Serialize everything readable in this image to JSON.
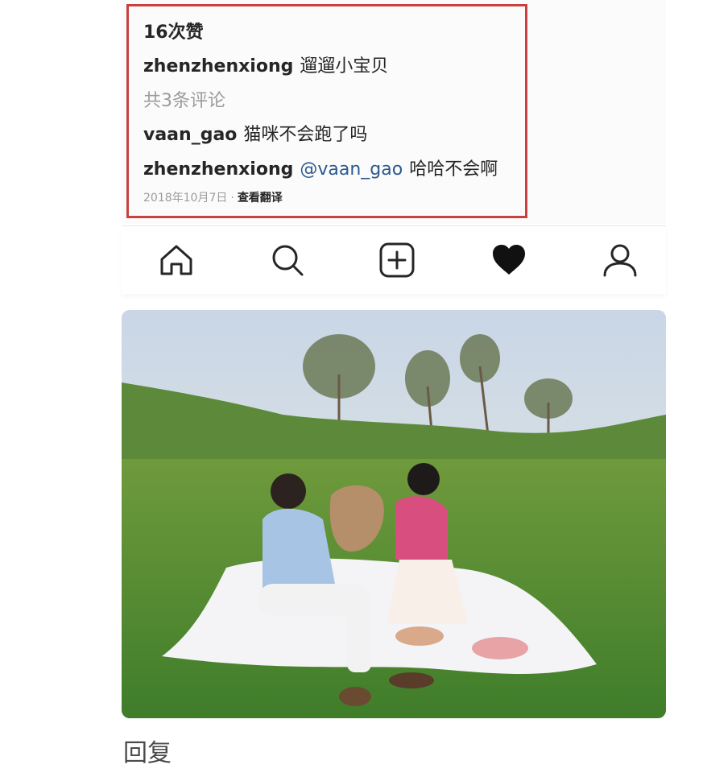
{
  "post": {
    "likes": "16次赞",
    "caption": {
      "user": "zhenzhenxiong",
      "text": "遛遛小宝贝"
    },
    "view_all_comments": "共3条评论",
    "comments": [
      {
        "user": "vaan_gao",
        "mention": "",
        "text": "猫咪不会跑了吗"
      },
      {
        "user": "zhenzhenxiong",
        "mention": "@vaan_gao",
        "text": "哈哈不会啊"
      }
    ],
    "date": "2018年10月7日",
    "separator": "·",
    "translate": "查看翻译"
  },
  "tabbar": {
    "icons": [
      "home-icon",
      "search-icon",
      "add-post-icon",
      "activity-heart-icon",
      "profile-icon"
    ],
    "active": "activity-heart-icon"
  },
  "colors": {
    "highlight_border": "#c8413f",
    "mention": "#2b5a8f",
    "muted_text": "#9b9b9b"
  },
  "reply_label": "回复"
}
